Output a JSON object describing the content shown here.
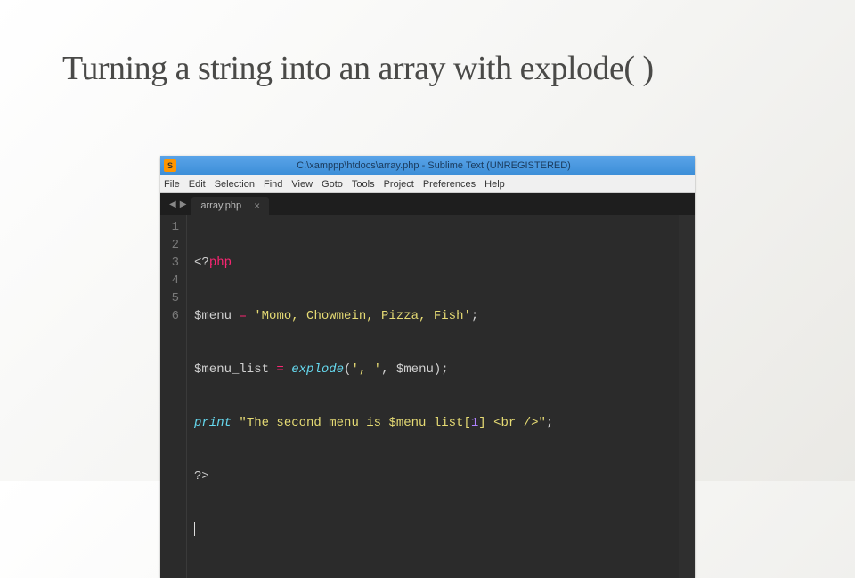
{
  "slide": {
    "title": "Turning a string into an array with explode( )"
  },
  "editor": {
    "titlebar": {
      "icon_letter": "S",
      "text": "C:\\xamppp\\htdocs\\array.php - Sublime Text (UNREGISTERED)"
    },
    "menu": {
      "file": "File",
      "edit": "Edit",
      "selection": "Selection",
      "find": "Find",
      "view": "View",
      "goto": "Goto",
      "tools": "Tools",
      "project": "Project",
      "preferences": "Preferences",
      "help": "Help"
    },
    "nav": {
      "back": "◀",
      "forward": "▶"
    },
    "tab": {
      "name": "array.php",
      "close": "×"
    },
    "gutter": [
      "1",
      "2",
      "3",
      "4",
      "5",
      "6"
    ],
    "code": {
      "l1": {
        "open": "<?",
        "php": "php"
      },
      "l2": {
        "var": "$menu",
        "eq": " = ",
        "str": "'Momo, Chowmein, Pizza, Fish'",
        "semi": ";"
      },
      "l3": {
        "var": "$menu_list",
        "eq": " = ",
        "func": "explode",
        "open": "(",
        "arg1": "', '",
        "comma": ", ",
        "arg2": "$menu",
        "close": ")",
        "semi": ";"
      },
      "l4": {
        "print": "print",
        "sp": " ",
        "str1": "\"The second menu is $menu_list[",
        "idx": "1",
        "str2": "] <br />\"",
        "semi": ";"
      },
      "l5": {
        "close": "?>"
      }
    }
  }
}
